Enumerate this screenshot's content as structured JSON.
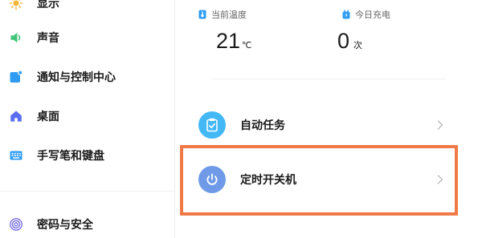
{
  "sidebar": {
    "items": [
      {
        "label": "显示",
        "icon": "sun-icon",
        "color": "#f5b638"
      },
      {
        "label": "声音",
        "icon": "speaker-icon",
        "color": "#43c47a"
      },
      {
        "label": "通知与控制中心",
        "icon": "notification-icon",
        "color": "#2f9cf2"
      },
      {
        "label": "桌面",
        "icon": "home-icon",
        "color": "#5b6ef0"
      },
      {
        "label": "手写笔和键盘",
        "icon": "keyboard-icon",
        "color": "#2f9cf2"
      },
      {
        "label": "密码与安全",
        "icon": "fingerprint-icon",
        "color": "#7b72e6"
      }
    ]
  },
  "stats": {
    "temperature": {
      "label": "当前温度",
      "value": "21",
      "unit": "℃",
      "icon": "thermometer-icon",
      "color": "#2f9cf2"
    },
    "charge": {
      "label": "今日充电",
      "value": "0",
      "unit": "次",
      "icon": "battery-plug-icon",
      "color": "#2f9cf2"
    }
  },
  "rows": [
    {
      "label": "自动任务",
      "icon": "clipboard-check-icon",
      "color": "#43b8f5"
    },
    {
      "label": "定时开关机",
      "icon": "power-icon",
      "color": "#6f9ae8"
    }
  ],
  "accent": {
    "highlight": "#f07a47"
  }
}
